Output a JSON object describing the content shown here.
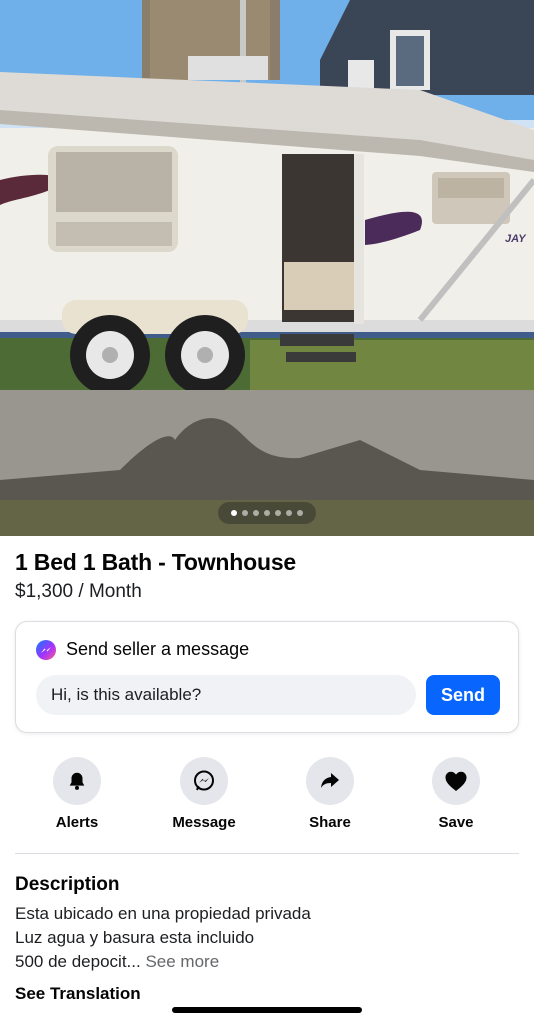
{
  "photo": {
    "carousel_count": 7,
    "carousel_active_index": 0,
    "trailer_brand_text": "JAY"
  },
  "listing": {
    "title": "1 Bed 1 Bath - Townhouse",
    "price": "$1,300 / Month"
  },
  "message_card": {
    "header": "Send seller a message",
    "input_value": "Hi, is this available?",
    "send_label": "Send"
  },
  "actions": [
    {
      "label": "Alerts",
      "icon": "bell-icon"
    },
    {
      "label": "Message",
      "icon": "messenger-icon"
    },
    {
      "label": "Share",
      "icon": "share-arrow-icon"
    },
    {
      "label": "Save",
      "icon": "heart-icon"
    }
  ],
  "description": {
    "title": "Description",
    "lines": [
      "Esta ubicado en una propiedad privada",
      "Luz agua y basura esta incluido",
      "500 de depocit..."
    ],
    "see_more": "See more",
    "see_translation": "See Translation"
  },
  "colors": {
    "accent": "#0866ff",
    "icon_bg": "#e4e6eb",
    "input_bg": "#f0f2f5"
  }
}
